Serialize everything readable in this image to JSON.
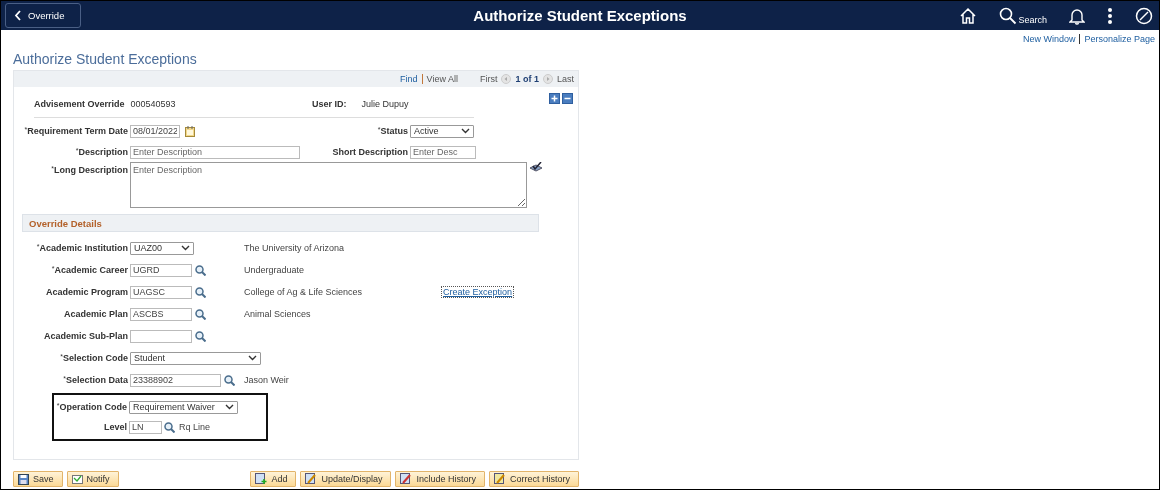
{
  "header": {
    "back": "Override",
    "title": "Authorize Student Exceptions",
    "search": "Search"
  },
  "links": [
    "New Window",
    "Personalize Page"
  ],
  "page_title": "Authorize Student Exceptions",
  "nav": {
    "find": "Find",
    "view_all": "View All",
    "first": "First",
    "count": "1 of 1",
    "last": "Last"
  },
  "summary": [
    {
      "label": "Advisement Override",
      "value": "000540593"
    },
    {
      "label": "User ID:",
      "value": "Julie Dupuy"
    }
  ],
  "top_rows": [
    [
      {
        "label": "$^{*}$Requirement Term Date",
        "kind": "date",
        "value": "08/01/2022"
      },
      {
        "label": "$^{*}$Status",
        "kind": "select",
        "value": "Active"
      }
    ],
    [
      {
        "label": "$^{*}$Description",
        "kind": "text",
        "placeholder": "Enter Description"
      },
      {
        "label": "Short Description",
        "kind": "text",
        "placeholder": "Enter Desc"
      }
    ]
  ],
  "long_description": {
    "label": "$^{*}$Long Description",
    "placeholder": "Enter Description"
  },
  "override": {
    "title": "Override Details",
    "rows": [
      {
        "label": "$^{*}$Academic Institution",
        "kind": "select",
        "value": "UAZ00",
        "description": "The University of Arizona"
      },
      {
        "label": "$^{*}$Academic Career",
        "kind": "lookup",
        "value": "UGRD",
        "description": "Undergraduate"
      },
      {
        "label": "Academic Program",
        "kind": "lookup",
        "value": "UAGSC",
        "description": "College of Ag & Life Sciences",
        "link": "Create Exception"
      },
      {
        "label": "Academic Plan",
        "kind": "lookup",
        "value": "ASCBS",
        "description": "Animal Sciences"
      },
      {
        "label": "Academic Sub-Plan",
        "kind": "lookup"
      },
      {
        "label": "$^{*}$Selection Code",
        "kind": "select",
        "value": "Student"
      },
      {
        "label": "$^{*}$Selection Data",
        "kind": "lookup",
        "value": "23388902",
        "description": "Jason Weir"
      }
    ],
    "highlighted_rows": [
      {
        "label": "$^{*}$Operation Code",
        "kind": "select",
        "value": "Requirement Waiver"
      },
      {
        "label": "Level",
        "kind": "lookup",
        "value": "LN",
        "description": "Rq Line"
      }
    ]
  },
  "buttons_left": [
    {
      "label": "Save",
      "kind": "save"
    },
    {
      "label": "Notify",
      "kind": "notify"
    }
  ],
  "buttons_right": [
    {
      "label": "Add",
      "kind": "add"
    },
    {
      "label": "Update/Display",
      "kind": "update"
    },
    {
      "label": "Include History",
      "kind": "history"
    },
    {
      "label": "Correct History",
      "kind": "correct"
    }
  ]
}
